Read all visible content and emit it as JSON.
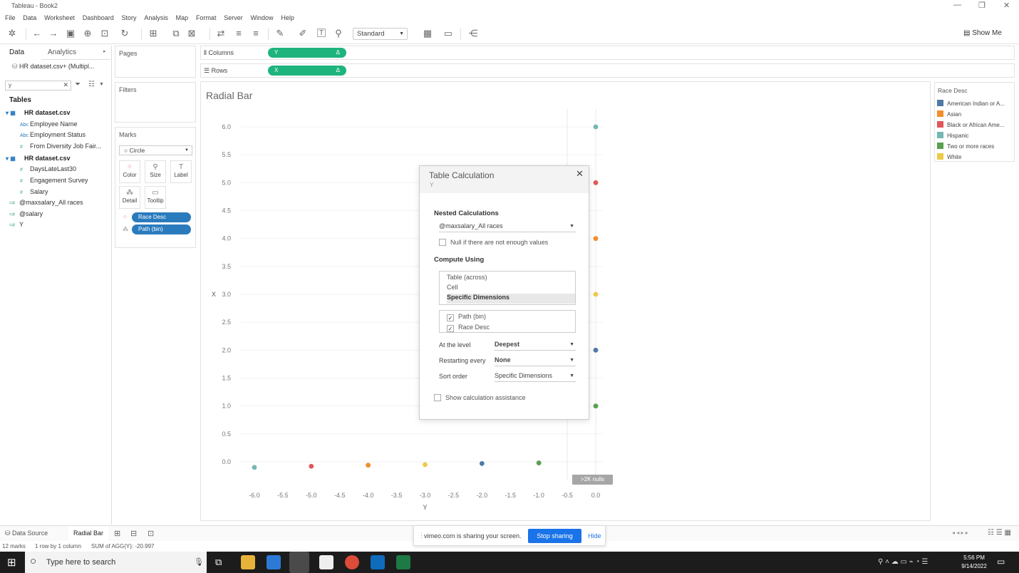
{
  "window": {
    "title": "Tableau - Book2"
  },
  "menu": [
    "File",
    "Data",
    "Worksheet",
    "Dashboard",
    "Story",
    "Analysis",
    "Map",
    "Format",
    "Server",
    "Window",
    "Help"
  ],
  "toolbar": {
    "fit": "Standard",
    "show_me": "Show Me"
  },
  "data_pane": {
    "tabs": [
      "Data",
      "Analytics"
    ],
    "datasource": "HR dataset.csv+ (Multipl...",
    "search_value": "y",
    "tables_label": "Tables",
    "fields": [
      {
        "label": "HR dataset.csv",
        "kind": "table",
        "icon": "table-icon"
      },
      {
        "label": "Employee Name",
        "kind": "dim",
        "icon": "abc-icon"
      },
      {
        "label": "Employment Status",
        "kind": "dim",
        "icon": "abc-icon"
      },
      {
        "label": "From Diversity Job Fair...",
        "kind": "measure",
        "icon": "hash-icon"
      },
      {
        "label": "HR dataset.csv",
        "kind": "table",
        "icon": "table-icon"
      },
      {
        "label": "DaysLateLast30",
        "kind": "measure",
        "icon": "hash-icon"
      },
      {
        "label": "Engagement Survey",
        "kind": "measure",
        "icon": "hash-icon"
      },
      {
        "label": "Salary",
        "kind": "measure",
        "icon": "hash-icon"
      },
      {
        "label": "@maxsalary_All races",
        "kind": "calc",
        "icon": "calc-icon"
      },
      {
        "label": "@salary",
        "kind": "calc",
        "icon": "calc-icon"
      },
      {
        "label": "Y",
        "kind": "calc",
        "icon": "calc-icon"
      }
    ]
  },
  "shelves": {
    "pages": "Pages",
    "filters": "Filters",
    "marks": "Marks",
    "columns_label": "Columns",
    "rows_label": "Rows",
    "columns_pill": "Y",
    "rows_pill": "X",
    "pill_delta": "Δ",
    "mark_type": "Circle",
    "mark_cards": [
      "Color",
      "Size",
      "Label",
      "Detail",
      "Tooltip"
    ],
    "mark_pills": [
      "Race Desc",
      "Path (bin)"
    ]
  },
  "view": {
    "title": "Radial Bar",
    "nulls_badge": ">2K nulls"
  },
  "chart_data": {
    "type": "scatter",
    "xlabel": "Y",
    "ylabel": "X",
    "xlim": [
      -6.0,
      0.0
    ],
    "ylim": [
      0.0,
      6.0
    ],
    "xticks": [
      "-6.0",
      "-5.5",
      "-5.0",
      "-4.5",
      "-4.0",
      "-3.5",
      "-3.0",
      "-2.5",
      "-2.0",
      "-1.5",
      "-1.0",
      "-0.5",
      "0.0"
    ],
    "yticks": [
      "6.0",
      "5.5",
      "5.0",
      "4.5",
      "4.0",
      "3.5",
      "3.0",
      "2.5",
      "2.0",
      "1.5",
      "1.0",
      "0.5",
      "0.0"
    ],
    "points": [
      {
        "x": 0.0,
        "y": 6.0,
        "series": "Hispanic"
      },
      {
        "x": 0.0,
        "y": 5.0,
        "series": "Black or African Ame..."
      },
      {
        "x": 0.0,
        "y": 4.0,
        "series": "Asian"
      },
      {
        "x": 0.0,
        "y": 3.0,
        "series": "White"
      },
      {
        "x": 0.0,
        "y": 2.0,
        "series": "American Indian or A..."
      },
      {
        "x": 0.0,
        "y": 1.0,
        "series": "Two or more races"
      },
      {
        "x": -6.0,
        "y": -0.1,
        "series": "Hispanic"
      },
      {
        "x": -5.0,
        "y": -0.08,
        "series": "Black or African Ame..."
      },
      {
        "x": -4.0,
        "y": -0.06,
        "series": "Asian"
      },
      {
        "x": -3.0,
        "y": -0.05,
        "series": "White"
      },
      {
        "x": -2.0,
        "y": -0.03,
        "series": "American Indian or A..."
      },
      {
        "x": -1.0,
        "y": -0.02,
        "series": "Two or more races"
      }
    ]
  },
  "legend": {
    "title": "Race Desc",
    "items": [
      {
        "label": "American Indian or A...",
        "color": "#4e79a7"
      },
      {
        "label": "Asian",
        "color": "#f28e2b"
      },
      {
        "label": "Black or African Ame...",
        "color": "#e15759"
      },
      {
        "label": "Hispanic",
        "color": "#76b7b2"
      },
      {
        "label": "Two or more races",
        "color": "#59a14f"
      },
      {
        "label": "White",
        "color": "#edc948"
      }
    ]
  },
  "dialog": {
    "title": "Table Calculation",
    "subtitle": "Y",
    "nested_label": "Nested Calculations",
    "nested_value": "@maxsalary_All races",
    "null_label": "Null if there are not enough values",
    "compute_label": "Compute Using",
    "compute_options": [
      "Table (across)",
      "Cell",
      "Specific Dimensions"
    ],
    "dimensions": [
      "Path (bin)",
      "Race Desc"
    ],
    "level_label": "At the level",
    "level_value": "Deepest",
    "restart_label": "Restarting every",
    "restart_value": "None",
    "sort_label": "Sort order",
    "sort_value": "Specific Dimensions",
    "assist_label": "Show calculation assistance"
  },
  "sheets": {
    "datasource_tab": "Data Source",
    "active_sheet": "Radial Bar"
  },
  "status": {
    "marks": "12 marks",
    "rows": "1 row by 1 column",
    "sum": "SUM of AGG(Y): -20.997"
  },
  "share_banner": {
    "message": "vimeo.com is sharing your screen.",
    "stop": "Stop sharing",
    "hide": "Hide"
  },
  "taskbar": {
    "search_placeholder": "Type here to search",
    "time": "5:56 PM",
    "date": "9/14/2022"
  }
}
